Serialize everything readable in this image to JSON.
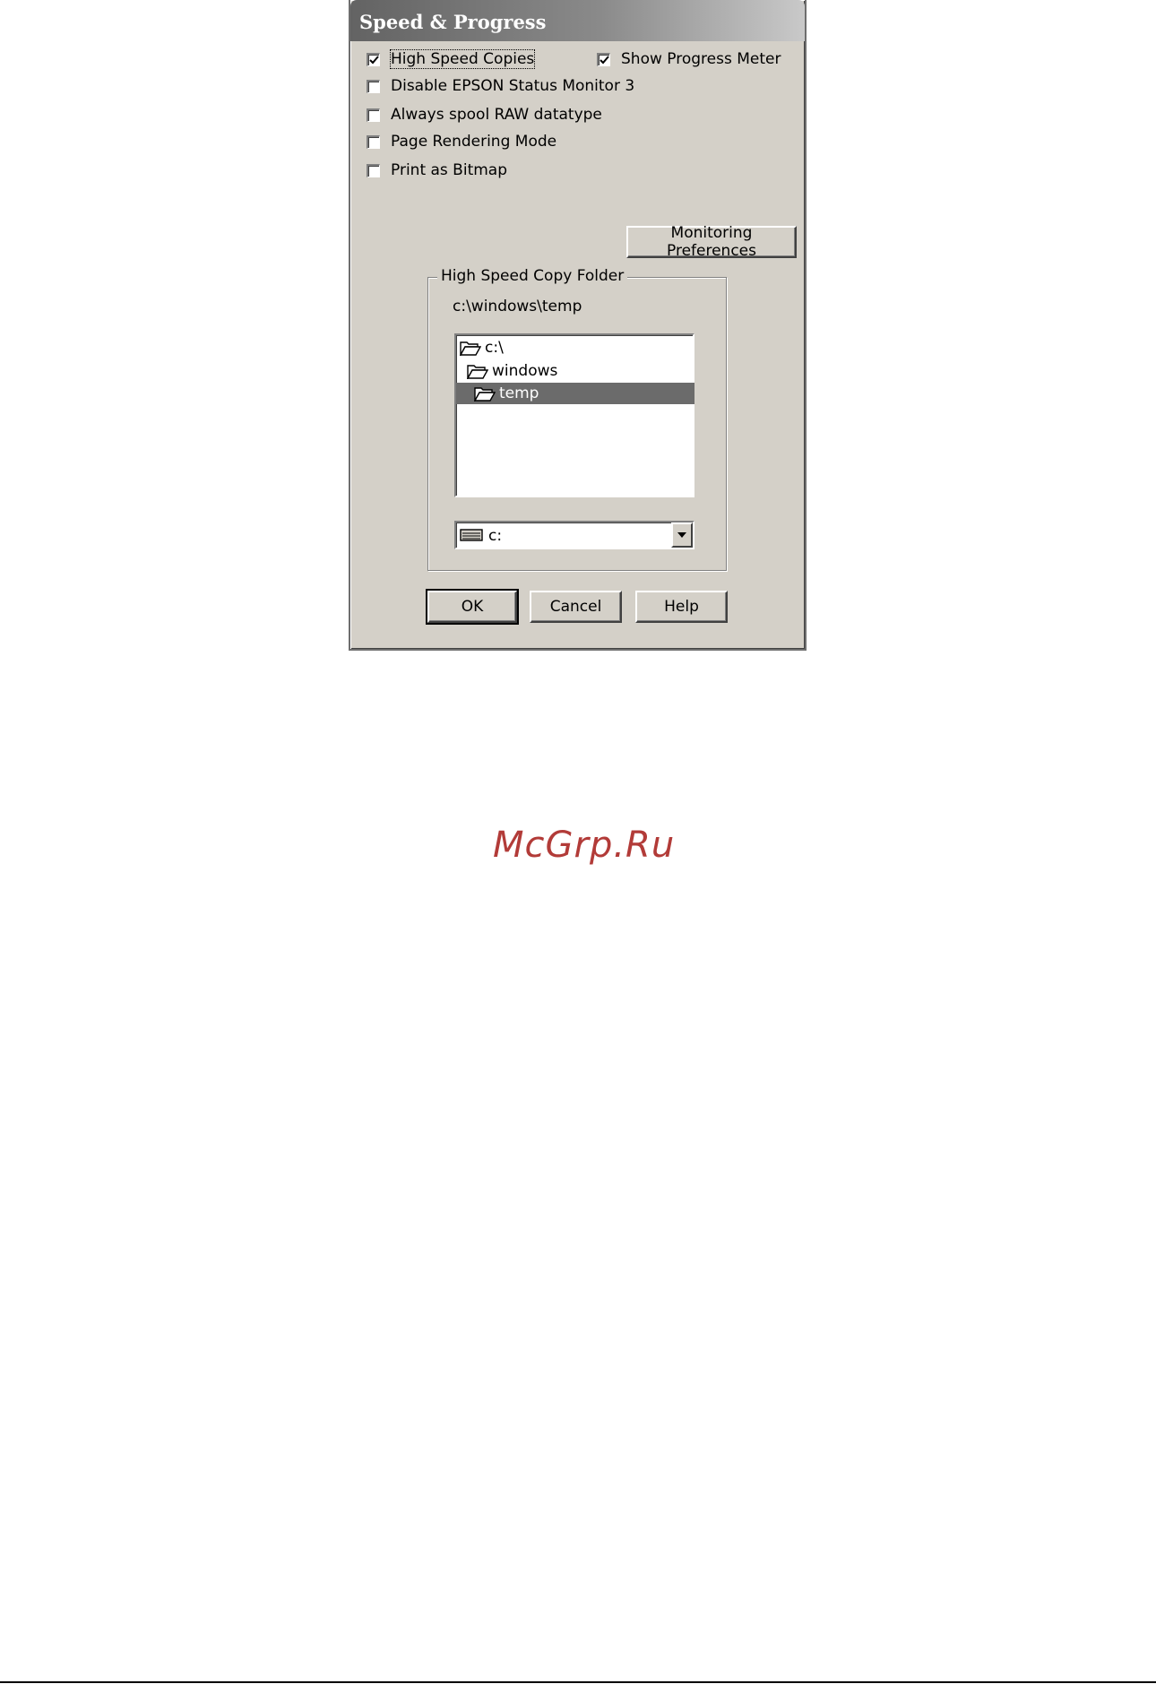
{
  "dialog": {
    "title": "Speed & Progress",
    "checkboxes": [
      {
        "label": "High Speed Copies",
        "checked": true
      },
      {
        "label": "Disable EPSON Status Monitor 3",
        "checked": false
      },
      {
        "label": "Always spool RAW datatype",
        "checked": false
      },
      {
        "label": "Page Rendering Mode",
        "checked": false
      },
      {
        "label": "Print as Bitmap",
        "checked": false
      }
    ],
    "show_progress": {
      "label": "Show Progress Meter",
      "checked": true
    },
    "monitoring_button": "Monitoring Preferences",
    "copy_folder": {
      "group_label": "High Speed Copy Folder",
      "path": "c:\\windows\\temp",
      "tree": [
        {
          "label": "c:\\",
          "selected": false
        },
        {
          "label": "windows",
          "selected": false
        },
        {
          "label": "temp",
          "selected": true
        }
      ],
      "drive": "c:"
    },
    "buttons": {
      "ok": "OK",
      "cancel": "Cancel",
      "help": "Help"
    }
  },
  "watermark": "McGrp.Ru"
}
